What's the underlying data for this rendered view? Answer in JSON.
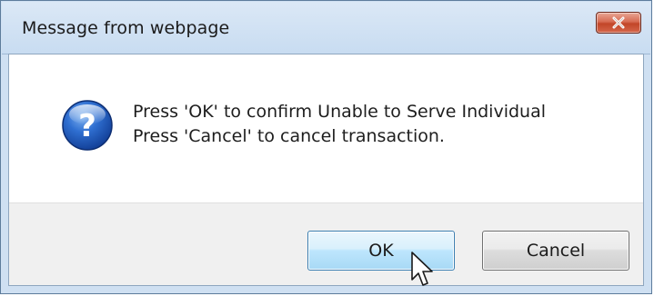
{
  "dialog": {
    "title": "Message from webpage",
    "close_icon": "close-icon",
    "icon": "question-icon",
    "message_lines": [
      "Press 'OK' to confirm Unable to Serve Individual",
      "Press 'Cancel' to cancel transaction."
    ],
    "buttons": {
      "ok": "OK",
      "cancel": "Cancel"
    }
  },
  "colors": {
    "title_bar": "#cfe0f2",
    "close_button": "#c24628",
    "ok_button_border": "#3c7fb1",
    "footer": "#f0f0f0"
  }
}
